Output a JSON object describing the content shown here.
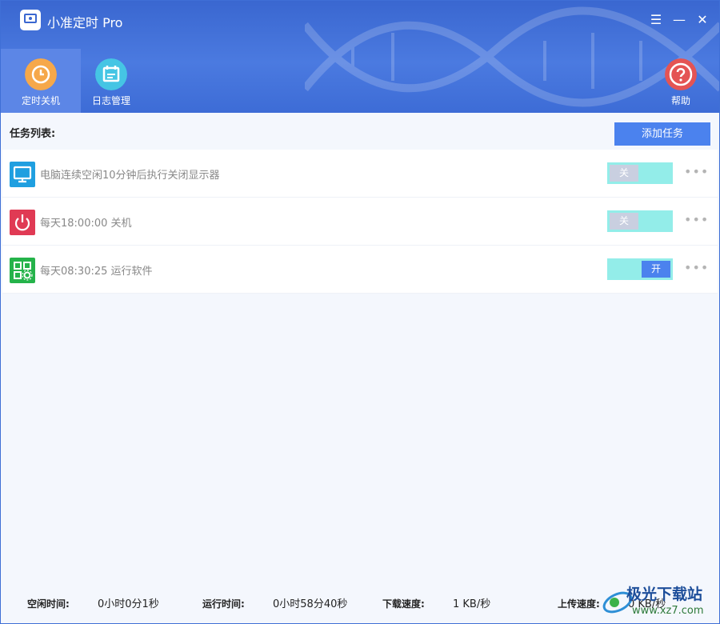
{
  "window": {
    "title": "小准定时 Pro"
  },
  "controls": {
    "menu": "☰",
    "minimize": "—",
    "close": "✕"
  },
  "nav": {
    "tabs": [
      {
        "label": "定时关机",
        "active": true,
        "color": "#f6a84a"
      },
      {
        "label": "日志管理",
        "active": false,
        "color": "#45c5e4"
      }
    ],
    "help_label": "帮助",
    "help_color": "#e45454"
  },
  "tasks": {
    "header": "任务列表:",
    "add_button": "添加任务",
    "items": [
      {
        "text": "电脑连续空闲10分钟后执行关闭显示器",
        "icon": "monitor-icon",
        "icon_color": "#1f9fe0",
        "switch": "关"
      },
      {
        "text": "每天18:00:00 关机",
        "icon": "power-icon",
        "icon_color": "#e03a54",
        "switch": "关"
      },
      {
        "text": "每天08:30:25 运行软件",
        "icon": "app-grid-icon",
        "icon_color": "#25b34a",
        "switch": "开"
      }
    ],
    "more": "•••"
  },
  "status": {
    "idle_label": "空闲时间:",
    "idle_value": "0小时0分1秒",
    "run_label": "运行时间:",
    "run_value": "0小时58分40秒",
    "down_label": "下载速度:",
    "down_value": "1 KB/秒",
    "up_label": "上传速度:",
    "up_value": "0 KB/秒"
  },
  "watermark": {
    "text": "极光下载站",
    "url": "www.xz7.com"
  }
}
